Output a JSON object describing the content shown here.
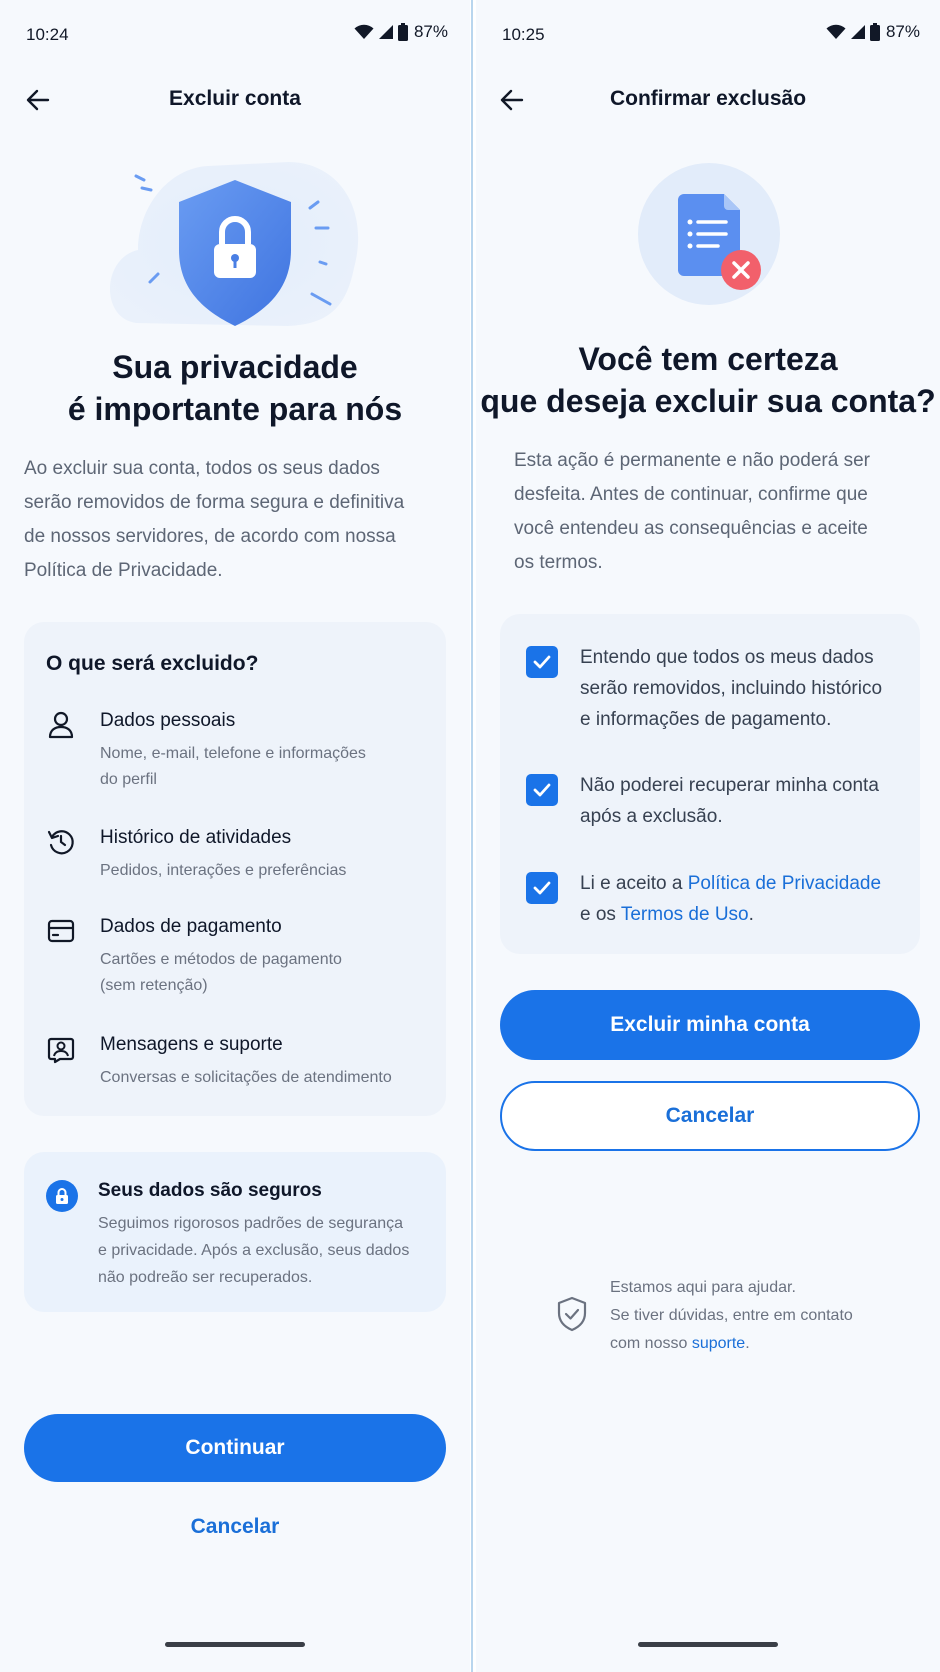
{
  "left": {
    "status": {
      "time": "10:24",
      "battery": "87%"
    },
    "header": {
      "title": "Excluir conta",
      "back_icon": "arrow-left-icon"
    },
    "headline": {
      "line1": "Sua privacidade",
      "line2": "é importante para nós"
    },
    "intro": {
      "lines": [
        "Ao excluir sua conta, todos os seus dados",
        "serão removidos de forma segura e definitiva",
        "de nossos servidores, de acordo com nossa",
        "Política de Privacidade."
      ]
    },
    "deleted": {
      "title": "O que será excluido?",
      "items": [
        {
          "icon": "person-icon",
          "title": "Dados pessoais",
          "desc_lines": [
            "Nome, e-mail, telefone e informações",
            "do perfil"
          ]
        },
        {
          "icon": "history-icon",
          "title": "Histórico de atividades",
          "desc_lines": [
            "Pedidos, interações e preferências"
          ]
        },
        {
          "icon": "credit-card-icon",
          "title": "Dados de pagamento",
          "desc_lines": [
            "Cartões e métodos de pagamento",
            "(sem retenção)"
          ]
        },
        {
          "icon": "chat-support-icon",
          "title": "Mensagens e suporte",
          "desc_lines": [
            "Conversas e solicitações de atendimento"
          ]
        }
      ]
    },
    "secure": {
      "title": "Seus dados são seguros",
      "desc_lines": [
        "Seguimos rigorosos padrões de segurança",
        "e privacidade. Após a exclusão, seus dados",
        "não podreão ser recuperados."
      ]
    },
    "continue_label": "Continuar",
    "cancel_label": "Cancelar"
  },
  "right": {
    "status": {
      "time": "10:25",
      "battery": "87%"
    },
    "header": {
      "title": "Confirmar exclusão",
      "back_icon": "arrow-left-icon"
    },
    "headline": {
      "line1": "Você tem certeza",
      "line2": "que deseja excluir sua conta?"
    },
    "intro": {
      "lines": [
        "Esta ação é permanente e não poderá ser",
        "desfeita. Antes de continuar, confirme que",
        "você entendeu as consequências e aceite",
        "os termos."
      ]
    },
    "checks": [
      {
        "checked": true,
        "lines": [
          "Entendo que todos os meus dados",
          "serão removidos, incluindo histórico",
          "e informações de pagamento."
        ]
      },
      {
        "checked": true,
        "lines": [
          "Não poderei recuperar minha conta",
          "após a exclusão."
        ]
      },
      {
        "checked": true,
        "pre": "Li e aceito a ",
        "link1": "Política de Privacidade",
        "mid": "e os ",
        "link2": "Termos de Uso",
        "post": "."
      }
    ],
    "delete_label": "Excluir minha conta",
    "cancel_label": "Cancelar",
    "help": {
      "line1": "Estamos aqui para ajudar.",
      "line2": "Se tiver dúvidas, entre em contato",
      "line3_pre": "com nosso ",
      "link": "suporte",
      "line3_post": "."
    }
  },
  "colors": {
    "primary": "#1a73e8",
    "background": "#f6f9fd",
    "card": "#eef3fa",
    "danger": "#f2606b"
  }
}
